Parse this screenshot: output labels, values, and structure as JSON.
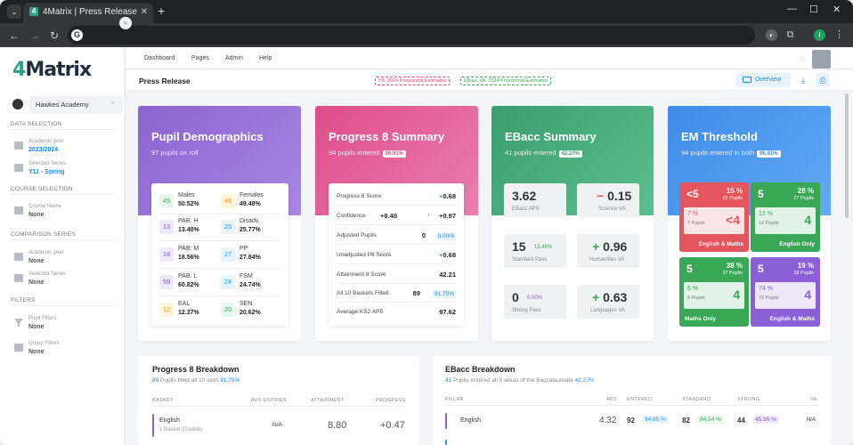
{
  "browser": {
    "tab_title": "4Matrix | Press Release",
    "favicon": "4",
    "profile_initial": "I"
  },
  "sidebar": {
    "logo_main": "4",
    "logo_rest": "Matrix",
    "school": "Hawkes Academy",
    "sections": {
      "data": "DATA SELECTION",
      "course": "COURSE SELECTION",
      "comparison": "COMPARISON SERIES",
      "filters": "FILTERS"
    },
    "items": [
      {
        "label": "Academic year",
        "value": "2023/2024"
      },
      {
        "label": "Selected Series",
        "value": "Y11 - Spring"
      },
      {
        "label": "Course Name",
        "value": "None"
      },
      {
        "label": "Academic year",
        "value": "None"
      },
      {
        "label": "Selected Series",
        "value": "None"
      },
      {
        "label": "Pupil Filters",
        "value": "None"
      },
      {
        "label": "Group Filters",
        "value": "None"
      }
    ]
  },
  "topnav": [
    "Dashboard",
    "Pages",
    "Admin",
    "Help"
  ],
  "page": {
    "title": "Press Release",
    "chip_p8": "P8: 2024 Provisional Estimates",
    "chip_ebacc": "EBacc VA: 2024 Provisional Estimates",
    "overview": "Overview"
  },
  "demographics": {
    "title": "Pupil Demographics",
    "subtitle": "97 pupils on roll",
    "items": [
      {
        "count": "49",
        "name": "Males",
        "pct": "50.52%",
        "color": "#e8f7ec",
        "text": "#3aa757"
      },
      {
        "count": "48",
        "name": "Females",
        "pct": "49.48%",
        "color": "#fff4dc",
        "text": "#e0a100"
      },
      {
        "count": "13",
        "name": "PAB: H",
        "pct": "13.40%",
        "color": "#efe9fb",
        "text": "#7e57c2"
      },
      {
        "count": "25",
        "name": "Disadv.",
        "pct": "25.77%",
        "color": "#e6f3fb",
        "text": "#2196f3"
      },
      {
        "count": "18",
        "name": "PAB: M",
        "pct": "18.56%",
        "color": "#efe9fb",
        "text": "#7e57c2"
      },
      {
        "count": "27",
        "name": "PP",
        "pct": "27.84%",
        "color": "#e6f3fb",
        "text": "#2196f3"
      },
      {
        "count": "59",
        "name": "PAB: L",
        "pct": "60.82%",
        "color": "#efe9fb",
        "text": "#7e57c2"
      },
      {
        "count": "24",
        "name": "FSM",
        "pct": "24.74%",
        "color": "#e6f3fb",
        "text": "#2196f3"
      },
      {
        "count": "12",
        "name": "EAL",
        "pct": "12.37%",
        "color": "#fff4dc",
        "text": "#e0a100"
      },
      {
        "count": "20",
        "name": "SEN",
        "pct": "20.62%",
        "color": "#e8f7ec",
        "text": "#3aa757"
      }
    ]
  },
  "progress8": {
    "title": "Progress 8 Summary",
    "subtitle": "94 pupils entered",
    "pill": "96.91%",
    "rows": {
      "score_label": "Progress 8 Score",
      "score_sign": "+",
      "score": "0.68",
      "conf_label": "Confidence",
      "conf_low": "+0.40",
      "conf_high": "+0.97",
      "adj_label": "Adjusted Pupils",
      "adj_value": "0",
      "adj_pct": "0.00%",
      "unadj_label": "Unadjusted P8 Score",
      "unadj_sign": "+",
      "unadj_value": "0.68",
      "att_label": "Attainment 8 Score",
      "att_value": "42.21",
      "baskets_label": "All 10 Baskets Filled",
      "baskets_value": "89",
      "baskets_pct": "91.75%",
      "ks2_label": "Average KS2 APS",
      "ks2_value": "97.62"
    }
  },
  "ebacc": {
    "title": "EBacc Summary",
    "subtitle": "41 pupils entered",
    "pill": "42.27%",
    "aps": "3.62",
    "aps_label": "EBacc APS",
    "sci_sign": "−",
    "sci": "0.15",
    "sci_label": "Science VA",
    "std": "15",
    "std_pct": "15.46%",
    "std_label": "Standard Pass",
    "hum_sign": "+",
    "hum": "0.96",
    "hum_label": "Humanities VA",
    "strong": "0",
    "strong_pct": "0.00%",
    "strong_label": "Strong Pass",
    "lang_sign": "+",
    "lang": "0.63",
    "lang_label": "Languages VA"
  },
  "em": {
    "title": "EM Threshold",
    "subtitle": "94 pupils entered in both",
    "pill": "96.91%",
    "tiles": [
      {
        "n": "<5",
        "pct": "15 %",
        "pupils": "15 Pupils",
        "in_a": "7 %",
        "in_b": "7 Pupils",
        "in_c": "<4",
        "foot": "English & Maths",
        "color": "#e5555e"
      },
      {
        "n": "5",
        "pct": "28 %",
        "pupils": "27 Pupils",
        "in_a": "12 %",
        "in_b": "12 Pupils",
        "in_c": "4",
        "foot": "English Only",
        "color": "#3aa757"
      },
      {
        "n": "5",
        "pct": "38 %",
        "pupils": "37 Pupils",
        "in_a": "6 %",
        "in_b": "6 Pupils",
        "in_c": "4",
        "foot": "Maths Only",
        "color": "#3aa757"
      },
      {
        "n": "5",
        "pct": "19 %",
        "pupils": "18 Pupils",
        "in_a": "74 %",
        "in_b": "72 Pupils",
        "in_c": "4",
        "foot": "English & Maths",
        "color": "#8b5fd6"
      }
    ]
  },
  "p8_breakdown": {
    "title": "Progress 8 Breakdown",
    "sub_count": "89",
    "sub_text": "Pupils filled all 10 slots",
    "sub_pct": "91.75%",
    "headers": [
      "BASKET",
      "AVG ENTRIES",
      "ATTAINMENT",
      "PROGRESS"
    ],
    "row": {
      "name": "English",
      "detail": "1 Basket (Double)",
      "entries": "N/A",
      "attainment": "8.80",
      "progress": "+0.47"
    }
  },
  "ebacc_breakdown": {
    "title": "EBacc Breakdown",
    "sub_count": "41",
    "sub_text": "Pupils entered all 5 areas of the Baccalaureate",
    "sub_pct": "42.27%",
    "headers": [
      "PILLAR",
      "APS",
      "ENTERED",
      "STANDARD",
      "STRONG",
      "VA"
    ],
    "row": {
      "name": "English",
      "aps": "4.32",
      "entered": "92",
      "entered_pct": "94.85 %",
      "standard": "82",
      "standard_pct": "84.54 %",
      "strong": "44",
      "strong_pct": "45.36 %",
      "va": "N/A"
    }
  }
}
